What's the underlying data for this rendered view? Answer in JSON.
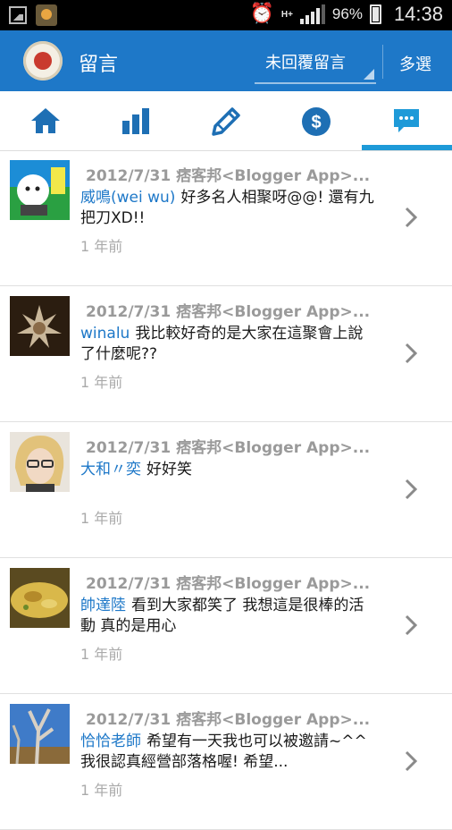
{
  "status_bar": {
    "network": "H+",
    "battery": "96%",
    "time": "14:38"
  },
  "header": {
    "title": "留言",
    "filter_label": "未回覆留言",
    "multi_select_label": "多選"
  },
  "tabs": [
    {
      "icon": "home-icon",
      "active": false
    },
    {
      "icon": "bar-chart-icon",
      "active": false
    },
    {
      "icon": "pencil-icon",
      "active": false
    },
    {
      "icon": "dollar-icon",
      "active": false
    },
    {
      "icon": "comment-icon",
      "active": true
    }
  ],
  "comments": [
    {
      "meta": "2012/7/31 痞客邦<Blogger App>...",
      "author": "威鳴(wei wu)",
      "text": "好多名人相聚呀@@! 還有九把刀XD!!",
      "time": "1 年前"
    },
    {
      "meta": "2012/7/31 痞客邦<Blogger App>...",
      "author": "winalu",
      "text": "我比較好奇的是大家在這聚會上說了什麼呢??",
      "time": "1 年前"
    },
    {
      "meta": "2012/7/31 痞客邦<Blogger App>...",
      "author": "大和〃奕",
      "text": "好好笑",
      "time": "1 年前"
    },
    {
      "meta": "2012/7/31 痞客邦<Blogger App>...",
      "author": "帥達陸",
      "text": "看到大家都笑了 我想這是很棒的活動 真的是用心",
      "time": "1 年前"
    },
    {
      "meta": "2012/7/31 痞客邦<Blogger App>...",
      "author": "恰恰老師",
      "text": "希望有一天我也可以被邀請~^^ 我很認真經營部落格喔! 希望...",
      "time": "1 年前"
    }
  ],
  "colors": {
    "header_bg": "#1e78c8",
    "accent": "#1e9ad8",
    "author": "#1e78c8"
  }
}
